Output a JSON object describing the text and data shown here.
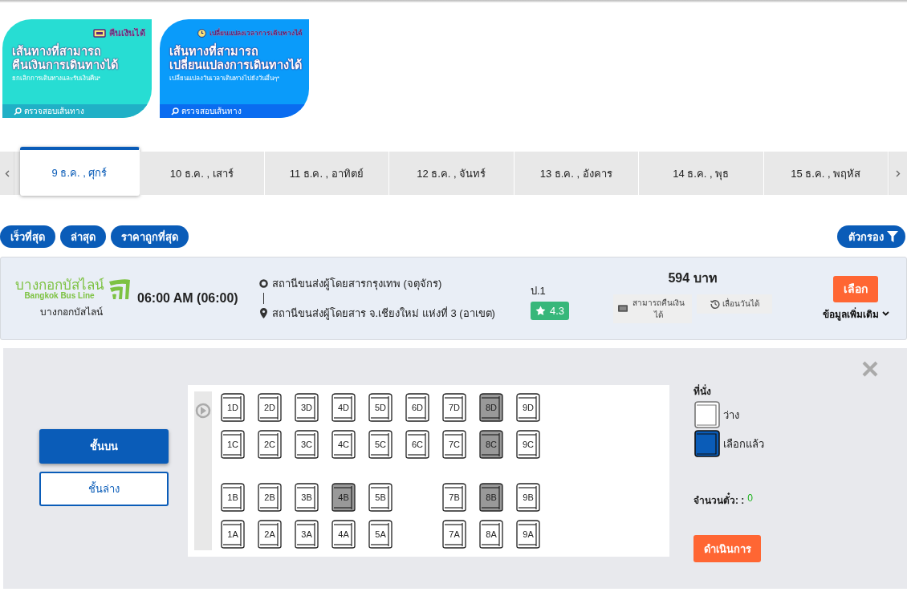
{
  "banners": [
    {
      "kind": "refund",
      "badge": "คืนเงินได้",
      "title_lines": [
        "เส้นทางที่สามารถ",
        "คืนเงินการเดินทางได้"
      ],
      "subtitle": "ยกเลิกการเดินทางและรับเงินคืน*",
      "link": "ตรวจสอบเส้นทาง"
    },
    {
      "kind": "reschedule",
      "badge": "เปลี่ยนแปลงเวลาการเดินทางได้",
      "title_lines": [
        "เส้นทางที่สามารถ",
        "เปลี่ยนแปลงการเดินทางได้"
      ],
      "subtitle": "เปลี่ยนแปลงวันเวลาเดินทางไปยังวันอื่นๆ*",
      "link": "ตรวจสอบเส้นทาง"
    }
  ],
  "date_tabs": [
    {
      "label": "9 ธ.ค. , ศุกร์",
      "selected": true
    },
    {
      "label": "10 ธ.ค. , เสาร์",
      "selected": false
    },
    {
      "label": "11 ธ.ค. , อาทิตย์",
      "selected": false
    },
    {
      "label": "12 ธ.ค. , จันทร์",
      "selected": false
    },
    {
      "label": "13 ธ.ค. , อังคาร",
      "selected": false
    },
    {
      "label": "14 ธ.ค. , พุธ",
      "selected": false
    },
    {
      "label": "15 ธ.ค. , พฤหัส",
      "selected": false
    }
  ],
  "sort_buttons": [
    "เร็วที่สุด",
    "ล่าสุด",
    "ราคาถูกที่สุด"
  ],
  "filter_button": "ตัวกรอง",
  "trip": {
    "logo_thai": "บางกอกบัสไลน์",
    "logo_english": "Bangkok Bus Line",
    "operator": "บางกอกบัสไลน์",
    "departure": "06:00 AM (06:00)",
    "origin": "สถานีขนส่งผู้โดยสารกรุงเทพ (จตุจักร)",
    "destination": "สถานีขนส่งผู้โดยสาร จ.เชียงใหม่ แห่งที่ 3 (อาเขต)",
    "bus_class": "ป.1",
    "rating": "4.3",
    "price": "594 บาท",
    "features": [
      {
        "kind": "refund",
        "label": "สามารถคืนเงินได้"
      },
      {
        "kind": "reschedule",
        "label": "เลื่อนวันได้"
      }
    ],
    "select_button": "เลือก",
    "more_info": "ข้อมูลเพิ่มเติม"
  },
  "floors": [
    {
      "label": "ชั้นบน",
      "selected": true
    },
    {
      "label": "ชั้นล่าง",
      "selected": false
    }
  ],
  "seat_rows": [
    [
      {
        "kind": "seat",
        "label": "1D",
        "booked": false
      },
      {
        "kind": "seat",
        "label": "2D",
        "booked": false
      },
      {
        "kind": "seat",
        "label": "3D",
        "booked": false
      },
      {
        "kind": "seat",
        "label": "4D",
        "booked": false
      },
      {
        "kind": "seat",
        "label": "5D",
        "booked": false
      },
      {
        "kind": "seat",
        "label": "6D",
        "booked": false
      },
      {
        "kind": "seat",
        "label": "7D",
        "booked": false
      },
      {
        "kind": "seat",
        "label": "8D",
        "booked": true
      },
      {
        "kind": "seat",
        "label": "9D",
        "booked": false
      }
    ],
    [
      {
        "kind": "seat",
        "label": "1C",
        "booked": false
      },
      {
        "kind": "seat",
        "label": "2C",
        "booked": false
      },
      {
        "kind": "seat",
        "label": "3C",
        "booked": false
      },
      {
        "kind": "seat",
        "label": "4C",
        "booked": false
      },
      {
        "kind": "seat",
        "label": "5C",
        "booked": false
      },
      {
        "kind": "seat",
        "label": "6C",
        "booked": false
      },
      {
        "kind": "seat",
        "label": "7C",
        "booked": false
      },
      {
        "kind": "seat",
        "label": "8C",
        "booked": true
      },
      {
        "kind": "seat",
        "label": "9C",
        "booked": false
      }
    ],
    [
      {
        "kind": "seat",
        "label": "1B",
        "booked": false
      },
      {
        "kind": "seat",
        "label": "2B",
        "booked": false
      },
      {
        "kind": "seat",
        "label": "3B",
        "booked": false
      },
      {
        "kind": "seat",
        "label": "4B",
        "booked": true
      },
      {
        "kind": "seat",
        "label": "5B",
        "booked": false
      },
      {
        "kind": "gap"
      },
      {
        "kind": "seat",
        "label": "7B",
        "booked": false
      },
      {
        "kind": "seat",
        "label": "8B",
        "booked": true
      },
      {
        "kind": "seat",
        "label": "9B",
        "booked": false
      }
    ],
    [
      {
        "kind": "seat",
        "label": "1A",
        "booked": false
      },
      {
        "kind": "seat",
        "label": "2A",
        "booked": false
      },
      {
        "kind": "seat",
        "label": "3A",
        "booked": false
      },
      {
        "kind": "seat",
        "label": "4A",
        "booked": false
      },
      {
        "kind": "seat",
        "label": "5A",
        "booked": false
      },
      {
        "kind": "gap"
      },
      {
        "kind": "seat",
        "label": "7A",
        "booked": false
      },
      {
        "kind": "seat",
        "label": "8A",
        "booked": false
      },
      {
        "kind": "seat",
        "label": "9A",
        "booked": false
      }
    ]
  ],
  "legend": {
    "title": "ที่นั่ง",
    "items": [
      {
        "kind": "available",
        "label": "ว่าง"
      },
      {
        "kind": "chosen",
        "label": "เลือกแล้ว"
      }
    ]
  },
  "ticket_count": {
    "label": "จำนวนตั๋ว: :",
    "value": "0"
  },
  "proceed_button": "ดำเนินการ"
}
